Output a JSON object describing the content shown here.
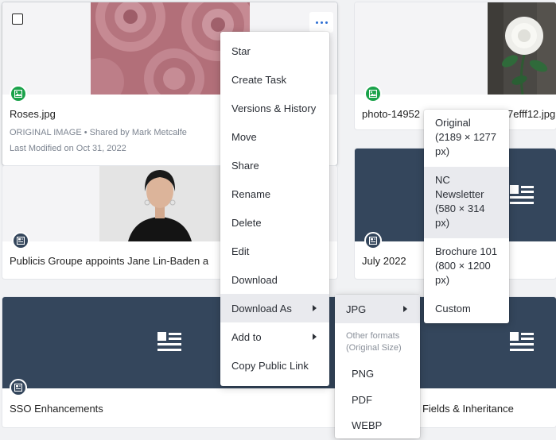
{
  "cards": {
    "roses": {
      "title": "Roses.jpg",
      "meta_type": "ORIGINAL IMAGE",
      "meta_sep": "•",
      "meta_shared": "Shared by Mark Metcalfe",
      "modified": "Last Modified on Oct 31, 2022"
    },
    "photo": {
      "title_left": "photo-14952",
      "title_right": "7efff12.jpg"
    },
    "publicis": {
      "title": "Publicis Groupe appoints Jane Lin-Baden a"
    },
    "july": {
      "title": "July 2022"
    },
    "sso": {
      "title": "SSO Enhancements"
    },
    "fields": {
      "title": "ing Fields & Inheritance"
    }
  },
  "context_menu": {
    "items": [
      {
        "label": "Star"
      },
      {
        "label": "Create Task"
      },
      {
        "label": "Versions & History"
      },
      {
        "label": "Move"
      },
      {
        "label": "Share"
      },
      {
        "label": "Rename"
      },
      {
        "label": "Delete"
      },
      {
        "label": "Edit"
      },
      {
        "label": "Download"
      },
      {
        "label": "Download As",
        "submenu": true,
        "active": true
      },
      {
        "label": "Add to",
        "submenu": true
      },
      {
        "label": "Copy Public Link"
      }
    ]
  },
  "download_as_menu": {
    "jpg_label": "JPG",
    "other_heading_line1": "Other formats",
    "other_heading_line2": "(Original Size)",
    "formats": [
      "PNG",
      "PDF",
      "WEBP"
    ]
  },
  "jpg_sizes_menu": {
    "sizes": [
      {
        "name": "Original",
        "dims_a": "(2189 × 1277",
        "dims_b": "px)"
      },
      {
        "name": "NC",
        "name2": "Newsletter",
        "dims_a": "(580 × 314",
        "dims_b": "px)",
        "active": true
      },
      {
        "name": "Brochure 101",
        "dims_a": "(800 × 1200",
        "dims_b": "px)"
      }
    ],
    "custom_label": "Custom"
  },
  "colors": {
    "accent": "#2f6fd3",
    "news_thumb": "#34465c",
    "image_badge": "#1aa24a",
    "menu_hover": "#e9eaee"
  },
  "icons": {
    "image_badge": "image-icon",
    "doc_badge": "newspaper-icon",
    "more": "more-horizontal-icon",
    "submenu": "chevron-right-icon"
  }
}
